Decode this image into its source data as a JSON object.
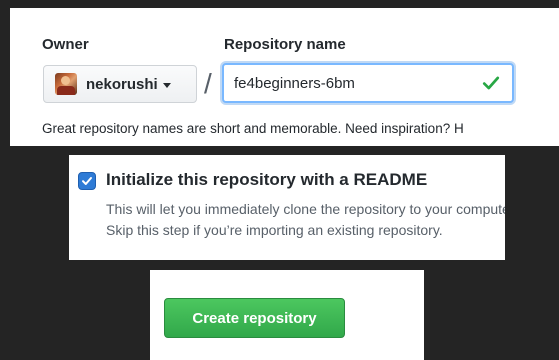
{
  "owner": {
    "label": "Owner",
    "selected": "nekorushi"
  },
  "repository": {
    "label": "Repository name",
    "value": "fe4beginners-6bm",
    "separator": "/",
    "helper_text": "Great repository names are short and memorable. Need inspiration? H"
  },
  "readme": {
    "checked": true,
    "label": "Initialize this repository with a README",
    "description": "This will let you immediately clone the repository to your computer. Skip this step if you’re importing an existing repository."
  },
  "actions": {
    "create_label": "Create repository"
  },
  "colors": {
    "background": "#242424",
    "valid_check": "#28a745",
    "checkbox": "#2e7bd6",
    "create_button": "#3db553"
  },
  "icons": {
    "valid": "check-icon",
    "dropdown": "caret-down-icon",
    "checkbox_mark": "check-icon"
  }
}
